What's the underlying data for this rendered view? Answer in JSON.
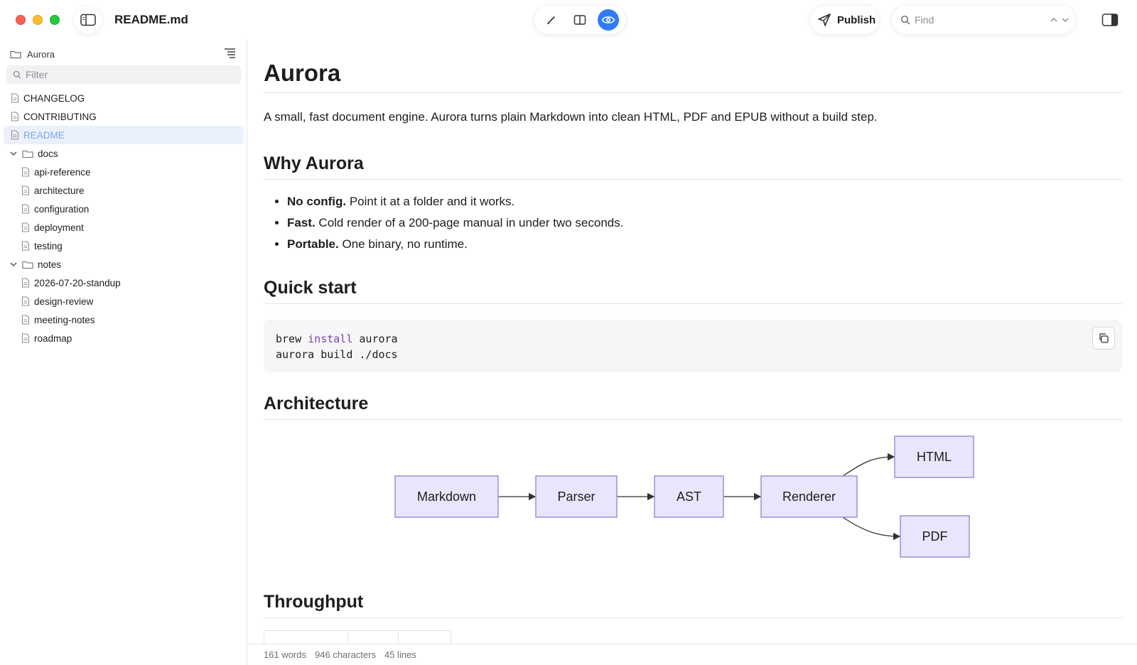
{
  "window": {
    "title": "README.md"
  },
  "toolbar": {
    "modes": [
      {
        "icon": "pencil-icon",
        "name": "edit"
      },
      {
        "icon": "split-view-icon",
        "name": "split"
      },
      {
        "icon": "eye-icon",
        "name": "preview",
        "active": true
      }
    ],
    "publish_label": "Publish",
    "find_placeholder": "Find"
  },
  "sidebar": {
    "folder_name": "Aurora",
    "filter_placeholder": "Filter",
    "items": [
      {
        "label": "CHANGELOG",
        "type": "file",
        "level": 0
      },
      {
        "label": "CONTRIBUTING",
        "type": "file",
        "level": 0
      },
      {
        "label": "README",
        "type": "file",
        "level": 0,
        "selected": true
      },
      {
        "label": "docs",
        "type": "folder",
        "level": 0,
        "expanded": true
      },
      {
        "label": "api-reference",
        "type": "file",
        "level": 1
      },
      {
        "label": "architecture",
        "type": "file",
        "level": 1
      },
      {
        "label": "configuration",
        "type": "file",
        "level": 1
      },
      {
        "label": "deployment",
        "type": "file",
        "level": 1
      },
      {
        "label": "testing",
        "type": "file",
        "level": 1
      },
      {
        "label": "notes",
        "type": "folder",
        "level": 0,
        "expanded": true
      },
      {
        "label": "2026-07-20-standup",
        "type": "file",
        "level": 1
      },
      {
        "label": "design-review",
        "type": "file",
        "level": 1
      },
      {
        "label": "meeting-notes",
        "type": "file",
        "level": 1
      },
      {
        "label": "roadmap",
        "type": "file",
        "level": 1
      }
    ]
  },
  "document": {
    "title": "Aurora",
    "lead": "A small, fast document engine. Aurora turns plain Markdown into clean HTML, PDF and EPUB without a build step.",
    "why_heading": "Why Aurora",
    "bullets": [
      {
        "strong": "No config.",
        "text": " Point it at a folder and it works."
      },
      {
        "strong": "Fast.",
        "text": " Cold render of a 200-page manual in under two seconds."
      },
      {
        "strong": "Portable.",
        "text": " One binary, no runtime."
      }
    ],
    "quickstart_heading": "Quick start",
    "code": {
      "line1_cmd": "brew ",
      "line1_kw": "install",
      "line1_rest": " aurora",
      "line2": "aurora build ./docs"
    },
    "architecture_heading": "Architecture",
    "diagram": {
      "nodes": [
        "Markdown",
        "Parser",
        "AST",
        "Renderer",
        "HTML",
        "PDF"
      ],
      "edges": [
        [
          "Markdown",
          "Parser"
        ],
        [
          "Parser",
          "AST"
        ],
        [
          "AST",
          "Renderer"
        ],
        [
          "Renderer",
          "HTML"
        ],
        [
          "Renderer",
          "PDF"
        ]
      ]
    },
    "throughput_heading": "Throughput"
  },
  "status": {
    "words": "161 words",
    "characters": "946 characters",
    "lines": "45 lines"
  }
}
